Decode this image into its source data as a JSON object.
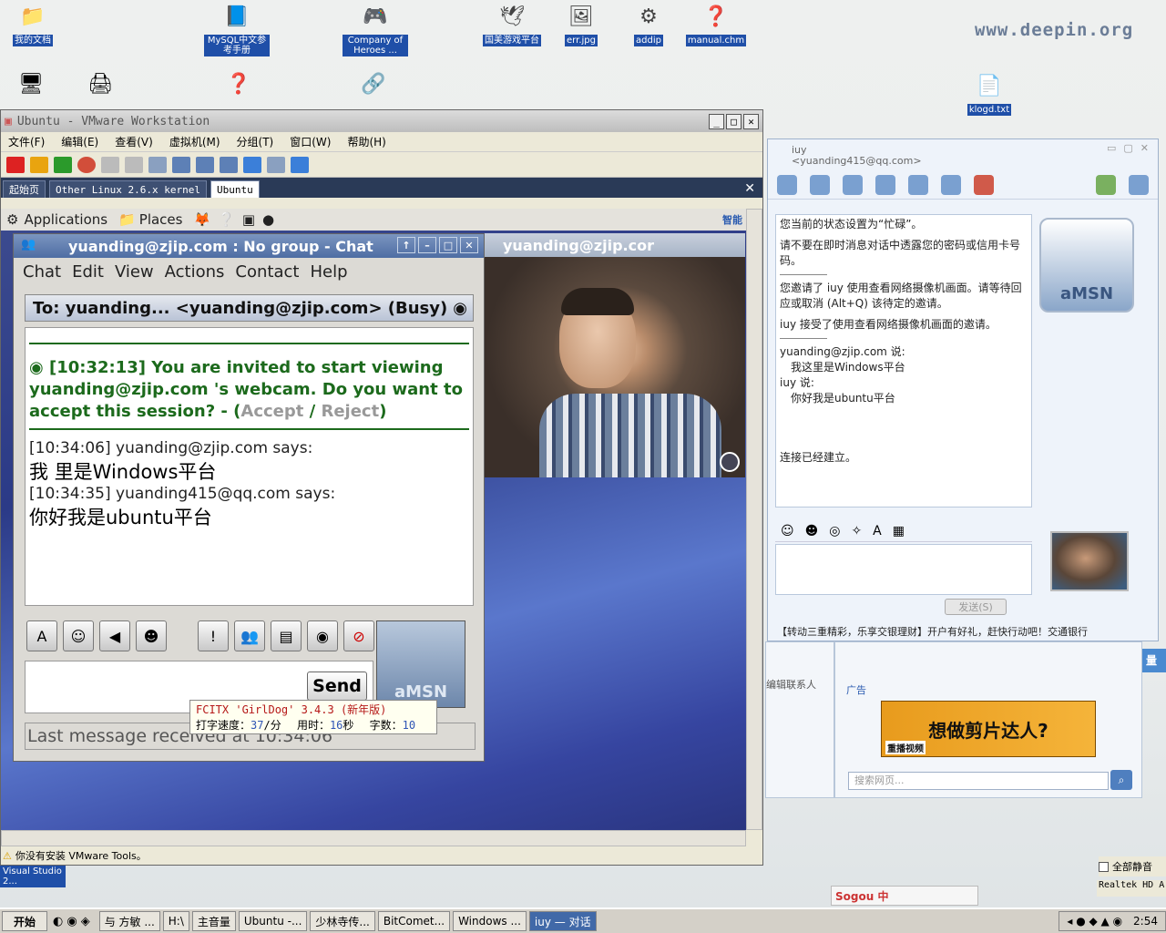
{
  "desktop": {
    "watermark": "www.deepin.org",
    "icons": [
      {
        "label": "我的文档",
        "glyph": "📁"
      },
      {
        "label": "MySQL中文参考手册",
        "glyph": "📘"
      },
      {
        "label": "Company of Heroes ...",
        "glyph": "🎮"
      },
      {
        "label": "国美游戏平台",
        "glyph": "🕊"
      },
      {
        "label": "err.jpg",
        "glyph": "🖼"
      },
      {
        "label": "addip",
        "glyph": "⚙"
      },
      {
        "label": "manual.chm",
        "glyph": "❓"
      },
      {
        "label": "klogd.txt",
        "glyph": "📄"
      }
    ],
    "vs_label": "Visual Studio 2..."
  },
  "vmware": {
    "title": "Ubuntu - VMware Workstation",
    "menu": [
      "文件(F)",
      "编辑(E)",
      "查看(V)",
      "虚拟机(M)",
      "分组(T)",
      "窗口(W)",
      "帮助(H)"
    ],
    "tabs": [
      "起始页",
      "Other Linux 2.6.x kernel",
      "Ubuntu"
    ],
    "status": "你没有安装 VMware Tools。"
  },
  "gnome": {
    "applications": "Applications",
    "places": "Places",
    "indicator": "智能"
  },
  "chat": {
    "title": "yuanding@zjip.com : No group - Chat",
    "menu": [
      "Chat",
      "Edit",
      "View",
      "Actions",
      "Contact",
      "Help"
    ],
    "to": "To: yuanding... <yuanding@zjip.com> (Busy)",
    "invite": "[10:32:13] You are invited to start viewing yuanding@zjip.com 's webcam. Do you want to accept this session? - (",
    "accept": "Accept",
    "reject": "Reject",
    "messages": [
      {
        "header": "[10:34:06] yuanding@zjip.com says:",
        "text": "我   里是Windows平台"
      },
      {
        "header": "[10:34:35] yuanding415@qq.com says:",
        "text": "你好我是ubuntu平台"
      }
    ],
    "send": "Send",
    "amsn_logo": "aMSN",
    "last_msg": "Last message received at 10:34:06"
  },
  "fcitx": {
    "title": "FCITX 'GirlDog' 3.4.3 (新年版)",
    "speed_label": "打字速度：",
    "speed": "37",
    "speed_unit": "/分",
    "time_label": "用时：",
    "time": "16",
    "time_unit": "秒",
    "count_label": "字数：",
    "count": "10"
  },
  "webcam": {
    "title": "yuanding@zjip.cor"
  },
  "amsn": {
    "title": "iuy",
    "subtitle": "<yuanding415@qq.com>",
    "lines": [
      "您当前的状态设置为“忙碌”。",
      "请不要在即时消息对话中透露您的密码或信用卡号码。",
      "您邀请了 iuy 使用查看网络摄像机画面。请等待回应或取消 (Alt+Q) 该待定的邀请。",
      "iuy 接受了使用查看网络摄像机画面的邀请。"
    ],
    "msg1_header": "yuanding@zjip.com 说:",
    "msg1_text": "我这里是Windows平台",
    "msg2_header": "iuy 说:",
    "msg2_text": "你好我是ubuntu平台",
    "connected": "连接已经建立。",
    "send": "发送(S)",
    "logo": "aMSN",
    "ad": "【转动三重精彩，乐享交银理财】开户有好礼，赶快行动吧！交通银行"
  },
  "side": {
    "edit_contact": "编辑联系人",
    "ad_label": "广告",
    "banner": "想做剪片达人?",
    "banner_sub": "重播视频",
    "search_placeholder": "搜索网页...",
    "mute": "全部静音",
    "realtek": "Realtek HD A",
    "sogou": "Sogou 中"
  },
  "taskbar": {
    "start": "开始",
    "tasks": [
      "与 方敏 ...",
      "H:\\",
      "主音量",
      "Ubuntu -...",
      "少林寺传...",
      "BitComet...",
      "Windows ...",
      "iuy — 对话"
    ],
    "time": "2:54"
  }
}
